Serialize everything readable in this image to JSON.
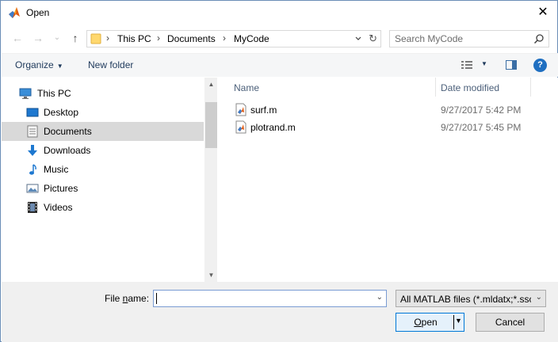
{
  "window": {
    "title": "Open",
    "close_glyph": "✕",
    "app_icon": "matlab-icon"
  },
  "nav": {
    "back_glyph": "←",
    "forward_glyph": "→",
    "recent_glyph": "⌄",
    "up_glyph": "↑",
    "breadcrumbs": [
      "This PC",
      "Documents",
      "MyCode"
    ],
    "separator": "›",
    "refresh_glyph": "↻",
    "search_placeholder": "Search MyCode"
  },
  "toolbar": {
    "organize": "Organize",
    "new_folder": "New folder",
    "help": "?"
  },
  "sidebar": {
    "items": [
      {
        "label": "This PC",
        "icon": "pc-icon"
      },
      {
        "label": "Desktop",
        "icon": "desktop-icon"
      },
      {
        "label": "Documents",
        "icon": "documents-icon",
        "selected": true
      },
      {
        "label": "Downloads",
        "icon": "downloads-icon"
      },
      {
        "label": "Music",
        "icon": "music-icon"
      },
      {
        "label": "Pictures",
        "icon": "pictures-icon"
      },
      {
        "label": "Videos",
        "icon": "videos-icon"
      }
    ]
  },
  "files": {
    "columns": {
      "name": "Name",
      "date": "Date modified"
    },
    "rows": [
      {
        "name": "surf.m",
        "date": "9/27/2017 5:42 PM",
        "icon": "matlab-file-icon"
      },
      {
        "name": "plotrand.m",
        "date": "9/27/2017 5:45 PM",
        "icon": "matlab-file-icon"
      }
    ]
  },
  "bottom": {
    "file_name_label_pre": "File ",
    "file_name_label_ul": "n",
    "file_name_label_post": "ame:",
    "file_name_value": "",
    "filter": "All MATLAB files (*.mldatx;*.ssc",
    "open_ul": "O",
    "open_rest": "pen",
    "cancel": "Cancel"
  },
  "colors": {
    "accent": "#0078d7",
    "selected": "#d9d9d9",
    "link": "#1e395b"
  }
}
